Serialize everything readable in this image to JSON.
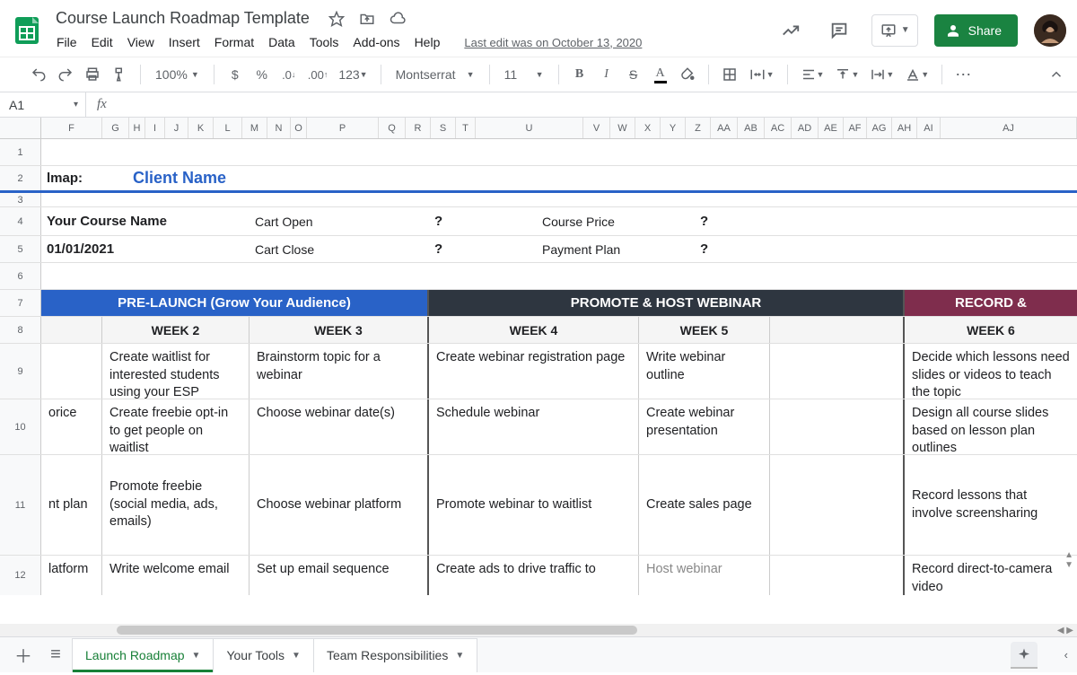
{
  "doc": {
    "title": "Course Launch Roadmap Template",
    "last_edit": "Last edit was on October 13, 2020"
  },
  "menu": [
    "File",
    "Edit",
    "View",
    "Insert",
    "Format",
    "Data",
    "Tools",
    "Add-ons",
    "Help"
  ],
  "toolbar": {
    "zoom": "100%",
    "font": "Montserrat",
    "size": "11",
    "number_fmt": "123"
  },
  "share": {
    "label": "Share"
  },
  "name_box": "A1",
  "columns": [
    "F",
    "G",
    "H",
    "I",
    "J",
    "K",
    "L",
    "M",
    "N",
    "O",
    "P",
    "Q",
    "R",
    "S",
    "T",
    "U",
    "V",
    "W",
    "X",
    "Y",
    "Z",
    "AA",
    "AB",
    "AC",
    "AD",
    "AE",
    "AF",
    "AG",
    "AH",
    "AI",
    "AJ"
  ],
  "col_widths": [
    "wF",
    "wG",
    "wH",
    "wI",
    "wJ",
    "wK",
    "wL",
    "wM",
    "wN",
    "wO",
    "wP",
    "wQ",
    "wR",
    "wS",
    "wT",
    "wU",
    "wV",
    "wW",
    "wX",
    "wY",
    "wZ",
    "wAA",
    "wAB",
    "wAC",
    "wAD",
    "wAE",
    "wAF",
    "wAG",
    "wAH",
    "wAI",
    "wAJ"
  ],
  "rows": {
    "r2": {
      "label_left": "lmap:",
      "client": "Client Name"
    },
    "r4": {
      "course_label": "Your Course Name",
      "cart_open": "Cart Open",
      "cart_open_val": "?",
      "price_label": "Course Price",
      "price_val": "?"
    },
    "r5": {
      "date": "01/01/2021",
      "cart_close": "Cart Close",
      "cart_close_val": "?",
      "plan_label": "Payment Plan",
      "plan_val": "?"
    },
    "phases": {
      "blue": "PRE-LAUNCH (Grow Your Audience)",
      "dark": "PROMOTE & HOST WEBINAR",
      "wine": "RECORD &"
    },
    "weeks": {
      "w2": "WEEK 2",
      "w3": "WEEK 3",
      "w4": "WEEK 4",
      "w5": "WEEK 5",
      "w6": "WEEK 6"
    },
    "r9": {
      "a": "",
      "b": "Create waitlist for interested students using your ESP",
      "c": "Brainstorm topic for a webinar",
      "d": "Create webinar registration page",
      "e": "Write webinar outline",
      "f": "",
      "g": "Decide which lessons need slides or videos to teach the topic"
    },
    "r10": {
      "a": "orice",
      "b": "Create freebie opt-in to get people on waitlist",
      "c": "Choose webinar date(s)",
      "d": "Schedule webinar",
      "e": "Create webinar presentation",
      "f": "",
      "g": "Design all course slides based on lesson plan outlines"
    },
    "r11": {
      "a": "nt plan",
      "b": "Promote freebie (social media, ads, emails)",
      "c": "Choose webinar platform",
      "d": "Promote webinar to waitlist",
      "e": "Create sales page",
      "f": "",
      "g": "Record lessons that involve screensharing"
    },
    "r12": {
      "a": "latform",
      "b": "Write welcome email",
      "c": "Set up email sequence",
      "d": "Create ads to drive traffic to",
      "e": "Host webinar",
      "f": "",
      "g": "Record direct-to-camera video"
    }
  },
  "sheets": {
    "s1": "Launch Roadmap",
    "s2": "Your Tools",
    "s3": "Team Responsibilities"
  }
}
